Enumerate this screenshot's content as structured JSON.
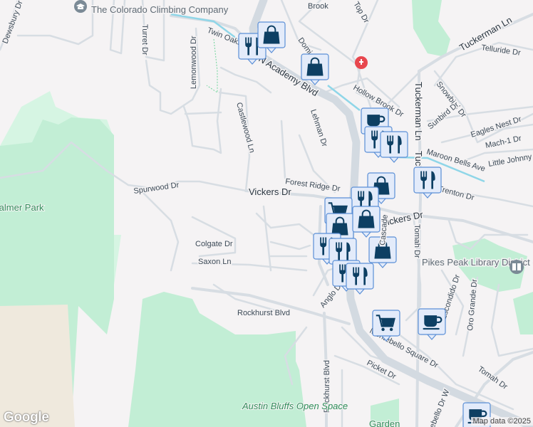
{
  "colors": {
    "background": "#f5f3f4",
    "park": "#c2eed5",
    "park_light": "#d6f5e3",
    "marker_fill": "#e3ebfa",
    "marker_icon": "#0d3f63",
    "hospital": "#e8474e"
  },
  "streets": {
    "dewsbury": "Dewsbury Dr",
    "turret": "Turret Dr",
    "lemonwood": "Lemonwood Dr",
    "twin_oaks": "Twin Oaks Dr",
    "academy": "N Academy Blvd",
    "castlewood": "Castlewood Ln",
    "spurwood": "Spurwood Dr",
    "vickers_w": "Vickers Dr",
    "vickers_e": "Vickers Dr",
    "forest_ridge": "Forest Ridge Dr",
    "lehman": "Lehman Dr",
    "brook": "Brook",
    "domi": "Domi",
    "top": "Top Dr",
    "hollow_brook": "Hollow Brook Dr",
    "tuckerman_n": "Tuckerman Ln",
    "tuckerman_v": "Tuckerman Ln",
    "tuc": "Tuc",
    "telluride": "Telluride Dr",
    "snowbird": "Snowbird Dr",
    "sunbird": "Sunbird Dr",
    "eagles_nest": "Eagles Nest Dr",
    "mach1": "Mach-1 Dr",
    "little_johnny": "Little Johnny",
    "maroon_bells": "Maroon Bells Ave",
    "trenton": "Trenton Dr",
    "colgate": "Colgate Dr",
    "saxon": "Saxon Ln",
    "rockhurst_h": "Rockhurst Blvd",
    "rockhurst_v": "Rockhurst Blvd",
    "anglo": "Anglo Dr",
    "tomah_v": "Tomah Dr",
    "tomah_d": "Tomah Dr",
    "escondido": "Escondido Dr",
    "oro_grande": "Oro Grande Dr",
    "bello_square": "Montebello Square Dr",
    "picket": "Picket Dr",
    "bello_w": "Montebello Dr W",
    "cascade": "Cascade"
  },
  "pois": {
    "climbing": "The Colorado Climbing Company",
    "library": "Pikes Peak Library District - East Library",
    "park_left": "Palmer Park",
    "austin_bluffs": "Austin Bluffs Open Space",
    "garden": "Garden"
  },
  "markers": [
    {
      "type": "restaurant"
    },
    {
      "type": "shopping"
    },
    {
      "type": "shopping"
    },
    {
      "type": "hospital"
    },
    {
      "type": "cafe"
    },
    {
      "type": "restaurant"
    },
    {
      "type": "restaurant"
    },
    {
      "type": "shopping"
    },
    {
      "type": "restaurant"
    },
    {
      "type": "restaurant"
    },
    {
      "type": "grocery"
    },
    {
      "type": "shopping"
    },
    {
      "type": "shopping"
    },
    {
      "type": "restaurant"
    },
    {
      "type": "restaurant"
    },
    {
      "type": "shopping"
    },
    {
      "type": "restaurant"
    },
    {
      "type": "restaurant"
    },
    {
      "type": "grocery"
    },
    {
      "type": "cafe"
    },
    {
      "type": "cafe"
    },
    {
      "type": "library"
    }
  ],
  "footer": {
    "logo": "Google",
    "attribution": "Map data ©2025"
  }
}
